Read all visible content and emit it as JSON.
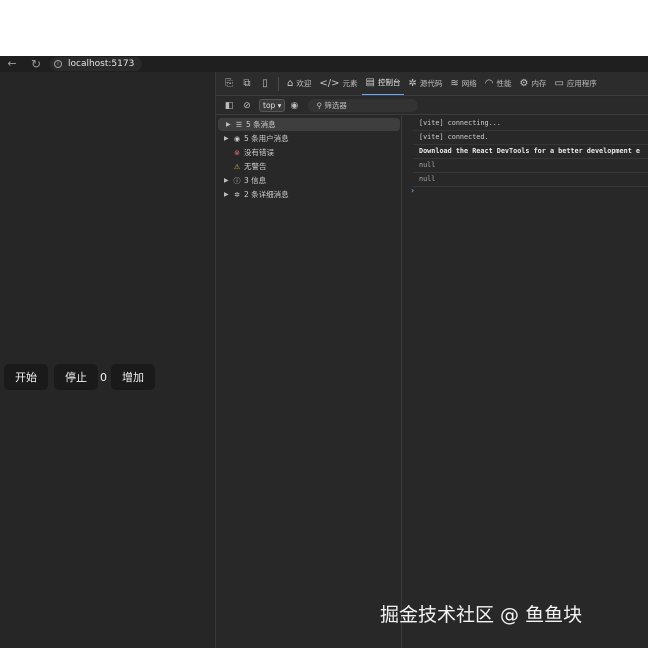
{
  "browser": {
    "url": "localhost:5173",
    "back_icon": "arrow-left-icon",
    "reload_icon": "reload-icon",
    "info_icon": "info-icon"
  },
  "page": {
    "start_label": "开始",
    "stop_label": "停止",
    "count": "0",
    "add_label": "增加"
  },
  "devtools": {
    "tabs": [
      {
        "label": "欢迎",
        "icon": "home-icon",
        "glyph": "⌂"
      },
      {
        "label": "元素",
        "icon": "code-icon",
        "glyph": "</>"
      },
      {
        "label": "控制台",
        "icon": "console-icon",
        "glyph": "▤"
      },
      {
        "label": "源代码",
        "icon": "bug-icon",
        "glyph": "✲"
      },
      {
        "label": "网络",
        "icon": "wifi-icon",
        "glyph": "≋"
      },
      {
        "label": "性能",
        "icon": "gauge-icon",
        "glyph": "◠"
      },
      {
        "label": "内存",
        "icon": "gear-icon",
        "glyph": "⚙"
      },
      {
        "label": "应用程序",
        "icon": "window-icon",
        "glyph": "▭"
      }
    ],
    "active_tab": "控制台",
    "toolbar": {
      "context": "top ▾",
      "filter_placeholder": "筛选器"
    },
    "sidebar": [
      {
        "label": "5 条消息",
        "icon": "list-icon",
        "glyph": "☰",
        "expandable": true,
        "selected": true
      },
      {
        "label": "5 条用户消息",
        "icon": "user-icon",
        "glyph": "◉",
        "expandable": true
      },
      {
        "label": "没有错误",
        "icon": "error-icon",
        "glyph": "⊗",
        "expandable": false
      },
      {
        "label": "无警告",
        "icon": "warning-icon",
        "glyph": "⚠",
        "expandable": false
      },
      {
        "label": "3 信息",
        "icon": "info-circle-icon",
        "glyph": "ⓘ",
        "expandable": true
      },
      {
        "label": "2 条详细消息",
        "icon": "verbose-icon",
        "glyph": "✲",
        "expandable": true
      }
    ],
    "logs": [
      {
        "text": "[vite] connecting...",
        "style": "normal"
      },
      {
        "text": "[vite] connected.",
        "style": "normal"
      },
      {
        "text": "Download the React DevTools for a better development e",
        "style": "bold"
      },
      {
        "text": "null",
        "style": "null"
      },
      {
        "text": "null",
        "style": "null"
      }
    ],
    "prompt": "›"
  },
  "watermark": "掘金技术社区 @ 鱼鱼块",
  "colors": {
    "page_bg": "#262626",
    "devtools_bg": "#282828",
    "active_tab_underline": "#6aa5ff",
    "error": "#e06a6a",
    "warning": "#e0b14a"
  }
}
